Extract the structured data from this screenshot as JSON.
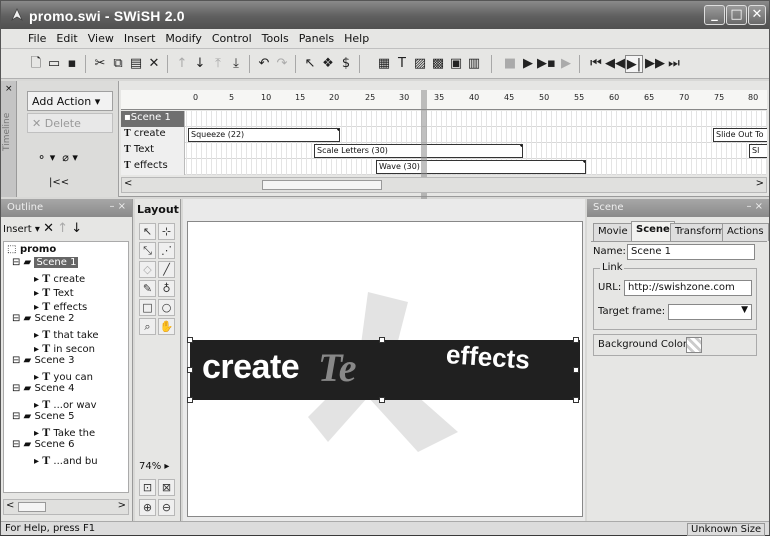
{
  "window": {
    "title": "promo.swi - SWiSH 2.0"
  },
  "menu": [
    "File",
    "Edit",
    "View",
    "Insert",
    "Modify",
    "Control",
    "Tools",
    "Panels",
    "Help"
  ],
  "timeline": {
    "vertical_tab": "Timeline",
    "add_action_label": "Add Action ▾",
    "delete_label": "Delete",
    "rewind_label": "|<<",
    "ruler_labels": [
      "0",
      "5",
      "10",
      "15",
      "20",
      "25",
      "30",
      "35",
      "40",
      "45",
      "50",
      "55",
      "60",
      "65",
      "70",
      "75",
      "80"
    ],
    "rows": [
      {
        "name": "Scene 1",
        "selected": true
      },
      {
        "name": "create"
      },
      {
        "name": "Text"
      },
      {
        "name": "effects"
      }
    ],
    "effects": [
      {
        "row": 1,
        "label": "Squeeze (22)"
      },
      {
        "row": 1,
        "label": "Slide Out To"
      },
      {
        "row": 2,
        "label": "Scale Letters (30)"
      },
      {
        "row": 2,
        "label": "Sl"
      },
      {
        "row": 3,
        "label": "Wave (30)"
      }
    ]
  },
  "outline": {
    "title": "Outline",
    "insert_label": "Insert ▾",
    "root": "promo",
    "items": [
      {
        "label": "Scene 1",
        "selected": true
      },
      {
        "label": "create"
      },
      {
        "label": "Text"
      },
      {
        "label": "effects"
      },
      {
        "label": "Scene 2"
      },
      {
        "label": "that take"
      },
      {
        "label": "in secon"
      },
      {
        "label": "Scene 3"
      },
      {
        "label": "you can"
      },
      {
        "label": "Scene 4"
      },
      {
        "label": "...or wav"
      },
      {
        "label": "Scene 5"
      },
      {
        "label": "Take the"
      },
      {
        "label": "Scene 6"
      },
      {
        "label": "...and bu"
      }
    ]
  },
  "layout": {
    "title": "Layout",
    "zoom_label": "74%"
  },
  "stage": {
    "banner_left": "create",
    "banner_mid": "Te",
    "banner_right": "effects"
  },
  "properties": {
    "title": "Scene",
    "tabs": [
      "Movie",
      "Scene",
      "Transform",
      "Actions"
    ],
    "active_tab": "Scene",
    "name_label": "Name:",
    "name_value": "Scene 1",
    "link_group": "Link",
    "url_label": "URL:",
    "url_value": "http://swishzone.com",
    "target_label": "Target frame:",
    "target_value": "",
    "bg_label": "Background Color"
  },
  "status": {
    "left": "For Help, press F1",
    "right": "Unknown Size"
  }
}
